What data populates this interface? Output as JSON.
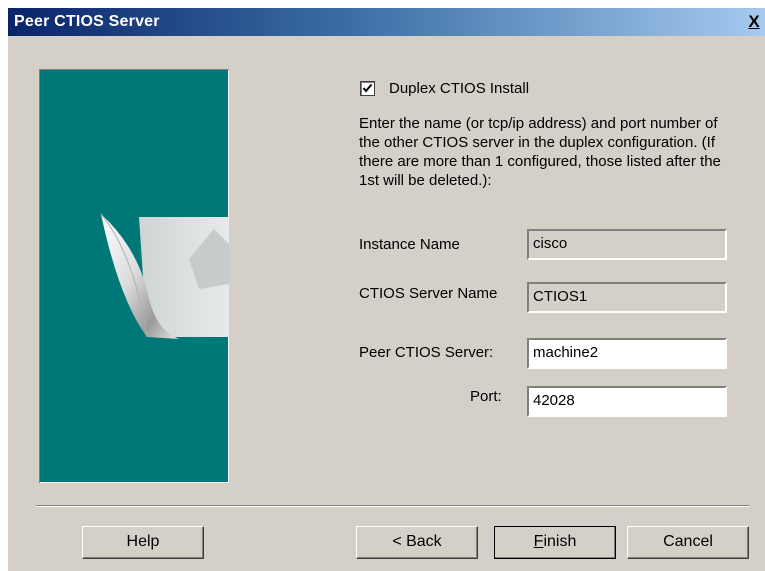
{
  "window": {
    "title": "Peer CTIOS Server",
    "close_glyph": "X"
  },
  "duplex": {
    "checked": true,
    "label": "Duplex CTIOS Install"
  },
  "instructions": "Enter the name (or tcp/ip address) and port number of the other CTIOS server in the duplex configuration. (If there are more than 1 configured, those listed after the 1st will be deleted.):",
  "fields": {
    "instance_name": {
      "label": "Instance Name",
      "value": "cisco"
    },
    "server_name": {
      "label": "CTIOS Server Name",
      "value": "CTIOS1"
    },
    "peer_server": {
      "label": "Peer CTIOS Server:",
      "value": "machine2"
    },
    "port": {
      "label": "Port:",
      "value": "42028"
    }
  },
  "buttons": {
    "help": "Help",
    "back": "< Back",
    "finish_mnemonic": "F",
    "finish_rest": "inish",
    "cancel": "Cancel"
  },
  "colors": {
    "panel": "#007878",
    "dialog_bg": "#d4d0c8",
    "title_start": "#0a246a",
    "title_end": "#a6caf0"
  },
  "icons": {
    "wizard_graphic": "page-curl-graphic",
    "check": "check-icon"
  }
}
